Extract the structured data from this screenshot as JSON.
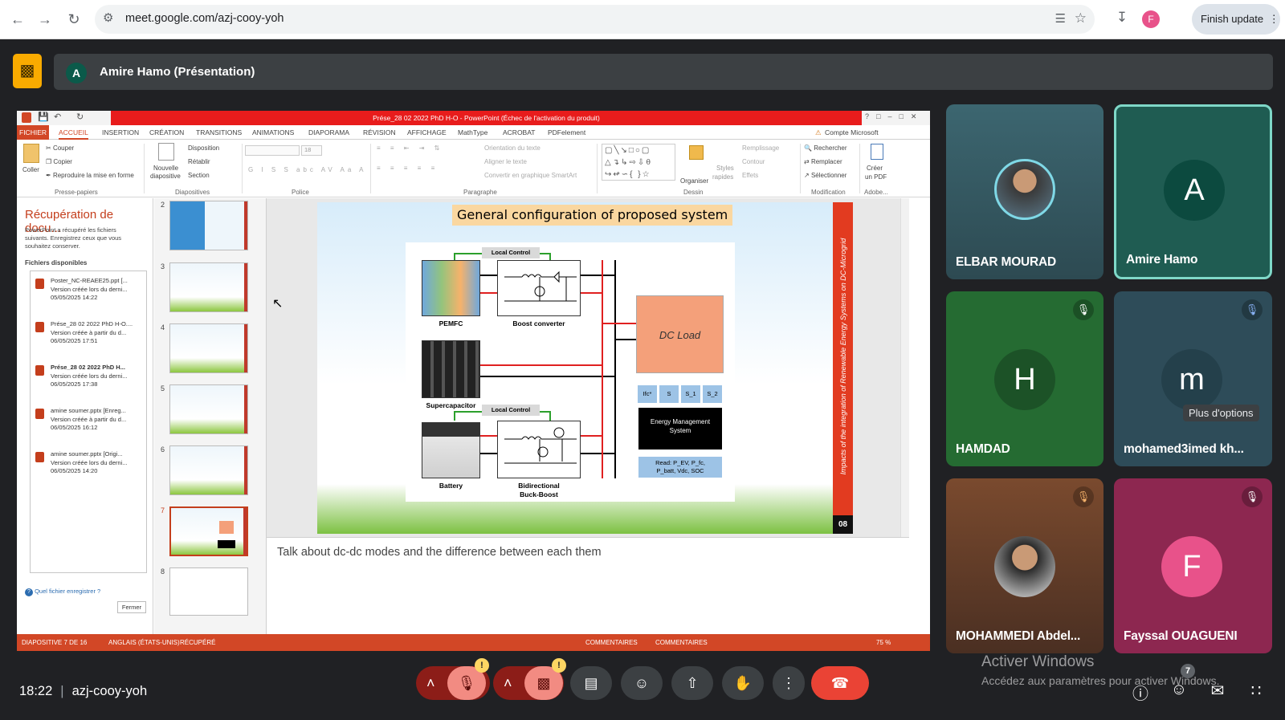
{
  "browser": {
    "url": "meet.google.com/azj-cooy-yoh",
    "profile_initial": "F",
    "finish_update": "Finish update"
  },
  "presenter": {
    "initial": "A",
    "label": "Amire Hamo (Présentation)"
  },
  "powerpoint": {
    "window_title": "Prése_28 02 2022 PhD H-O - PowerPoint (Échec de l'activation du produit)",
    "tabs": [
      "FICHIER",
      "ACCUEIL",
      "INSERTION",
      "CRÉATION",
      "TRANSITIONS",
      "ANIMATIONS",
      "DIAPORAMA",
      "RÉVISION",
      "AFFICHAGE",
      "MathType",
      "ACROBAT",
      "PDFelement"
    ],
    "account": "Compte Microsoft",
    "ribbon": {
      "coller": "Coller",
      "couper": "Couper",
      "copier": "Copier",
      "reproduire": "Reproduire la mise en forme",
      "presse": "Presse-papiers",
      "nouvelle": "Nouvelle",
      "diapositive": "diapositive",
      "disposition": "Disposition",
      "retablir": "Rétablir",
      "section": "Section",
      "diapositives": "Diapositives",
      "font_size": "18",
      "police": "Police",
      "orientation": "Orientation du texte",
      "aligner": "Aligner le texte",
      "convertir": "Convertir en graphique SmartArt",
      "paragraphe": "Paragraphe",
      "organiser": "Organiser",
      "styles": "Styles",
      "rapides": "rapides",
      "remplissage": "Remplissage",
      "contour": "Contour",
      "effets": "Effets",
      "dessin": "Dessin",
      "rechercher": "Rechercher",
      "remplacer": "Remplacer",
      "selectionner": "Sélectionner",
      "modification": "Modification",
      "creer": "Créer",
      "un_pdf": "un PDF",
      "adobe": "Adobe..."
    },
    "recovery": {
      "title": "Récupération de docu...",
      "desc1": "PowerPoint a récupéré les fichiers",
      "desc2": "suivants. Enregistrez ceux que vous",
      "desc3": "souhaitez conserver.",
      "files_header": "Fichiers disponibles",
      "files": [
        {
          "name": "Poster_NC-REAEE25.ppt  [...",
          "line2": "Version créée lors du derni...",
          "date": "05/05/2025 14:22"
        },
        {
          "name": "Prése_28 02 2022 PhD H-O....",
          "line2": "Version créée à partir du d...",
          "date": "06/05/2025 17:51"
        },
        {
          "name": "Prése_28 02 2022 PhD H...",
          "line2": "Version créée lors du derni...",
          "date": "06/05/2025 17:38"
        },
        {
          "name": "amine soumer.pptx  [Enreg...",
          "line2": "Version créée à partir du d...",
          "date": "06/05/2025 16:12"
        },
        {
          "name": "amine soumer.pptx  [Origi...",
          "line2": "Version créée lors du derni...",
          "date": "06/05/2025 14:20"
        }
      ],
      "help": "Quel fichier enregistrer ?",
      "close": "Fermer"
    },
    "thumb_numbers": [
      "2",
      "3",
      "4",
      "5",
      "6",
      "7",
      "8"
    ],
    "slide": {
      "title": "General configuration of proposed system",
      "side_text": "Impacts of the integration of Renewable Energy Systems on DC-Microgrid",
      "page": "08",
      "local_control": "Local Control",
      "pemfc": "PEMFC",
      "boost": "Boost converter",
      "supercap": "Supercapacitor",
      "battery": "Battery",
      "bidir1": "Bidirectional",
      "bidir2": "Buck-Boost",
      "dc_load": "DC Load",
      "arrows": [
        "Ifc*",
        "S",
        "S_1",
        "S_2"
      ],
      "ems1": "Energy Management",
      "ems2": "System",
      "read1": "Read: P_EV, P_fc,",
      "read2": "P_batt, Vdc, SOC"
    },
    "notes": "Talk about dc-dc modes and the difference between each them",
    "status": {
      "slide": "DIAPOSITIVE 7 DE 16",
      "lang": "ANGLAIS (ÉTATS-UNIS)",
      "recovered": "RÉCUPÉRÉ",
      "notes": "COMMENTAIRES",
      "comments": "COMMENTAIRES",
      "zoom": "75 %"
    }
  },
  "participants": [
    {
      "name": "ELBAR MOURAD"
    },
    {
      "name": "Amire Hamo",
      "initial": "A"
    },
    {
      "name": "HAMDAD",
      "initial": "H"
    },
    {
      "name": "mohamed3imed kh...",
      "initial": "m",
      "tooltip": "Plus d'options"
    },
    {
      "name": "MOHAMMEDI Abdel..."
    },
    {
      "name": "Fayssal OUAGUENI",
      "initial": "F"
    }
  ],
  "meeting": {
    "time": "18:22",
    "code": "azj-cooy-yoh",
    "participant_count": "7"
  },
  "watermark": {
    "line1": "Activer Windows",
    "line2": "Accédez aux paramètres pour activer Windows."
  },
  "colors": {
    "accent_red": "#ea4335",
    "ppt_orange": "#d24726"
  }
}
